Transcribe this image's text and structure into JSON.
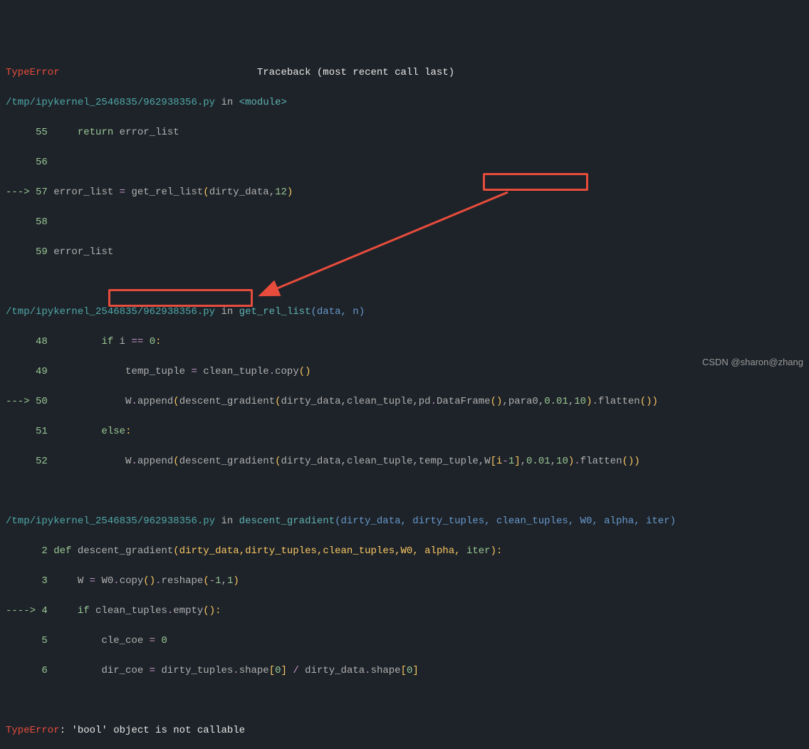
{
  "header": {
    "error_type": "TypeError",
    "traceback_label": "Traceback (most recent call last)"
  },
  "frame1": {
    "path": "/tmp/ipykernel_2546835/962938356.py",
    "in_label": " in ",
    "module": "<module>",
    "l55_num": "55",
    "l55_return": "return",
    "l55_var": " error_list",
    "l56_num": "56",
    "l57_arrow": "---> ",
    "l57_num": "57",
    "l57_var": " error_list ",
    "l57_op": "=",
    "l57_fn": " get_rel_list",
    "l57_p1": "(",
    "l57_arg1": "dirty_data",
    "l57_comma": ",",
    "l57_arg2": "12",
    "l57_p2": ")",
    "l58_num": "58",
    "l59_num": "59",
    "l59_var": " error_list"
  },
  "frame2": {
    "path": "/tmp/ipykernel_2546835/962938356.py",
    "in_label": " in ",
    "fn": "get_rel_list",
    "sig_open": "(data, n)",
    "l48_num": "48",
    "l48_if": "if",
    "l48_cond": " i ",
    "l48_op": "==",
    "l48_zero": " 0",
    "l48_colon": ":",
    "l49_num": "49",
    "l49_code": "temp_tuple ",
    "l49_op": "=",
    "l49_rhs": " clean_tuple",
    "l49_dot": ".",
    "l49_copy": "copy",
    "l49_p": "()",
    "l50_arrow": "---> ",
    "l50_num": "50",
    "l50_w": "W",
    "l50_dot1": ".",
    "l50_append": "append",
    "l50_p1": "(",
    "l50_fn": "descent_gradient",
    "l50_p2": "(",
    "l50_args1": "dirty_data",
    "l50_c1": ",",
    "l50_args2": "clean_tuple",
    "l50_c2": ",",
    "l50_pd": "pd",
    "l50_dot2": ".",
    "l50_df": "DataFrame",
    "l50_p3": "()",
    "l50_c3": ",",
    "l50_para": "para0",
    "l50_c4": ",",
    "l50_v1": "0.01",
    "l50_c5": ",",
    "l50_v2": "10",
    "l50_p4": ")",
    "l50_dot3": ".",
    "l50_flat": "flatten",
    "l50_p5": "())",
    "l51_num": "51",
    "l51_else": "else",
    "l51_colon": ":",
    "l52_num": "52",
    "l52_w": "W",
    "l52_dot1": ".",
    "l52_append": "append",
    "l52_p1": "(",
    "l52_fn": "descent_gradient",
    "l52_p2": "(",
    "l52_args1": "dirty_data",
    "l52_c1": ",",
    "l52_args2": "clean_tuple",
    "l52_c2": ",",
    "l52_args3": "temp_tuple",
    "l52_c3": ",",
    "l52_w2": "W",
    "l52_bracket": "[i",
    "l52_minus": "-",
    "l52_one": "1",
    "l52_bracket2": "]",
    "l52_c4": ",",
    "l52_v1": "0.01",
    "l52_c5": ",",
    "l52_v2": "10",
    "l52_p4": ")",
    "l52_dot3": ".",
    "l52_flat": "flatten",
    "l52_p5": "())"
  },
  "frame3": {
    "path": "/tmp/ipykernel_2546835/962938356.py",
    "in_label": " in ",
    "fn": "descent_gradient",
    "sig": "(dirty_data, dirty_tuples, clean_tuples, W0, alpha, iter)",
    "l2_num": "2",
    "l2_def": "def",
    "l2_name": " descent_gradient",
    "l2_sig": "(dirty_data,dirty_tuples,clean_tuples,W0, alpha, ",
    "l2_iter": "iter",
    "l2_p": "):",
    "l3_num": "3",
    "l3_w": "W ",
    "l3_op": "=",
    "l3_w0": " W0",
    "l3_dot1": ".",
    "l3_copy": "copy",
    "l3_p1": "()",
    "l3_dot2": ".",
    "l3_reshape": "reshape",
    "l3_p2": "(",
    "l3_neg": "-",
    "l3_v1": "1",
    "l3_c": ",",
    "l3_v2": "1",
    "l3_p3": ")",
    "l4_arrow": "----> ",
    "l4_num": "4",
    "l4_if": "if",
    "l4_ct": " clean_tuples",
    "l4_dot": ".",
    "l4_empty": "empty",
    "l4_p": "():",
    "l5_num": "5",
    "l5_var": "cle_coe ",
    "l5_op": "=",
    "l5_zero": " 0",
    "l6_num": "6",
    "l6_var": "dir_coe ",
    "l6_op": "=",
    "l6_dt": " dirty_tuples",
    "l6_dot1": ".",
    "l6_shape1": "shape",
    "l6_b1": "[",
    "l6_z1": "0",
    "l6_b2": "] ",
    "l6_div": "/",
    "l6_dd": " dirty_data",
    "l6_dot2": ".",
    "l6_shape2": "shape",
    "l6_b3": "[",
    "l6_z2": "0",
    "l6_b4": "]"
  },
  "footer": {
    "error_type": "TypeError",
    "colon": ": ",
    "message": "'bool' object is not callable"
  },
  "watermark": "CSDN @sharon@zhang"
}
